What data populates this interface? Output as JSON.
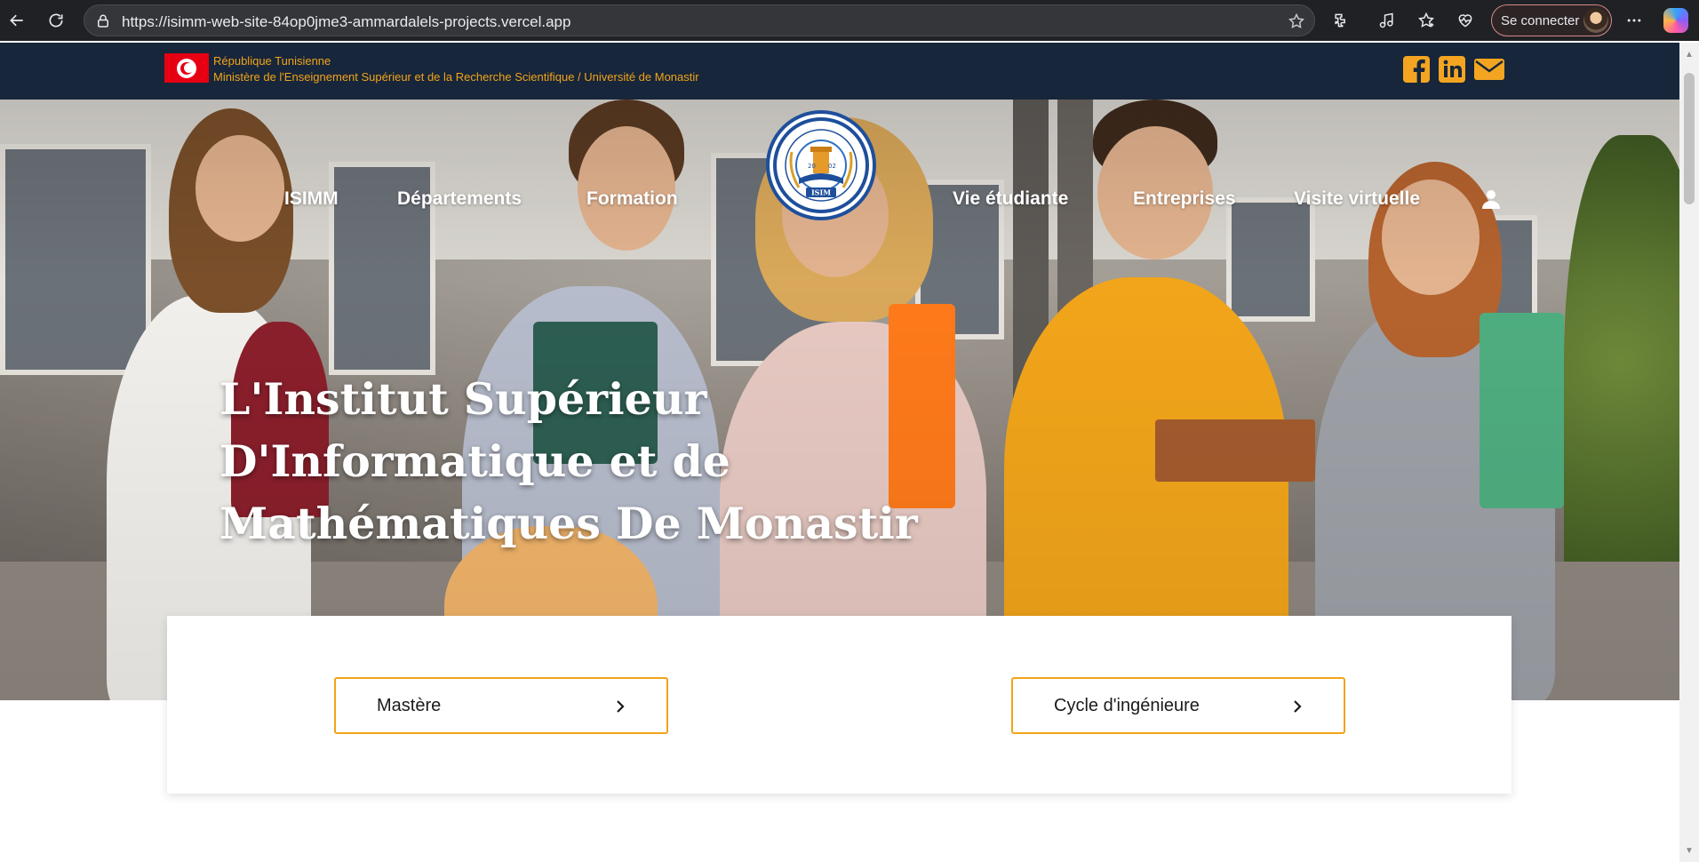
{
  "browser": {
    "url": "https://isimm-web-site-84op0jme3-ammardalels-projects.vercel.app",
    "signin_label": "Se connecter"
  },
  "topbar": {
    "republic": "République Tunisienne",
    "ministry": "Ministère de l'Enseignement Supérieur et de la Recherche Scientifique / Université de Monastir",
    "social": [
      "facebook-icon",
      "linkedin-icon",
      "mail-icon"
    ]
  },
  "nav": {
    "items": [
      "ISIMM",
      "Départements",
      "Formation",
      "Vie étudiante",
      "Entreprises",
      "Visite virtuelle"
    ],
    "logo_text": "ISIM"
  },
  "hero": {
    "title_lines": [
      "L'Institut Supérieur",
      "D'Informatique et de",
      "Mathématiques De Monastir"
    ]
  },
  "card": {
    "buttons": [
      "Mastère",
      "Cycle d'ingénieure"
    ]
  },
  "colors": {
    "accent": "#f2a31a",
    "topbar_bg": "#17263a",
    "logo_blue": "#1e4f9b"
  }
}
